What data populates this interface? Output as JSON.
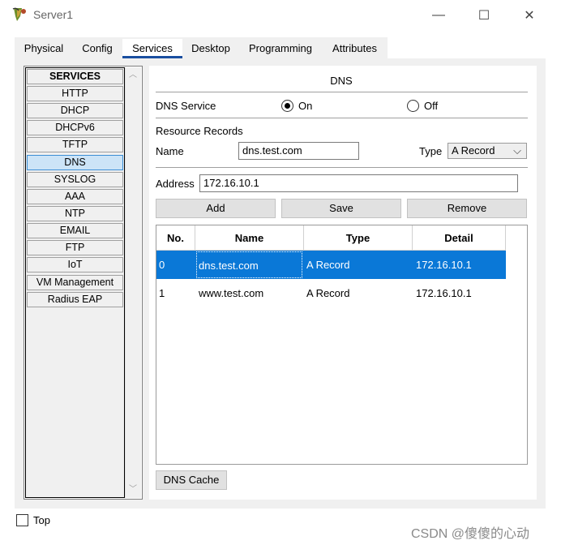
{
  "window": {
    "title": "Server1",
    "controls": {
      "minimize": "—",
      "maximize": "☐",
      "close": "✕"
    }
  },
  "tabs": [
    {
      "label": "Physical",
      "active": false
    },
    {
      "label": "Config",
      "active": false
    },
    {
      "label": "Services",
      "active": true
    },
    {
      "label": "Desktop",
      "active": false
    },
    {
      "label": "Programming",
      "active": false
    },
    {
      "label": "Attributes",
      "active": false
    }
  ],
  "sidebar": {
    "header": "SERVICES",
    "items": [
      "HTTP",
      "DHCP",
      "DHCPv6",
      "TFTP",
      "DNS",
      "SYSLOG",
      "AAA",
      "NTP",
      "EMAIL",
      "FTP",
      "IoT",
      "VM Management",
      "Radius EAP"
    ],
    "selected": "DNS"
  },
  "dns": {
    "section_title": "DNS",
    "service_label": "DNS Service",
    "on_label": "On",
    "off_label": "Off",
    "service_state": "On",
    "records_label": "Resource Records",
    "name_label": "Name",
    "name_value": "dns.test.com",
    "type_label": "Type",
    "type_value": "A Record",
    "address_label": "Address",
    "address_value": "172.16.10.1",
    "buttons": {
      "add": "Add",
      "save": "Save",
      "remove": "Remove"
    },
    "table": {
      "headers": [
        "No.",
        "Name",
        "Type",
        "Detail"
      ],
      "rows": [
        [
          "0",
          "dns.test.com",
          "A Record",
          "172.16.10.1"
        ],
        [
          "1",
          "www.test.com",
          "A Record",
          "172.16.10.1"
        ]
      ],
      "selected_row": 0
    },
    "cache_button": "DNS Cache"
  },
  "footer": {
    "top_label": "Top",
    "top_checked": false,
    "watermark": "CSDN @傻傻的心动"
  },
  "colors": {
    "selection": "#0a78d7",
    "tab_underline": "#1a4fa0",
    "panel_bg": "#f0f0f0"
  }
}
